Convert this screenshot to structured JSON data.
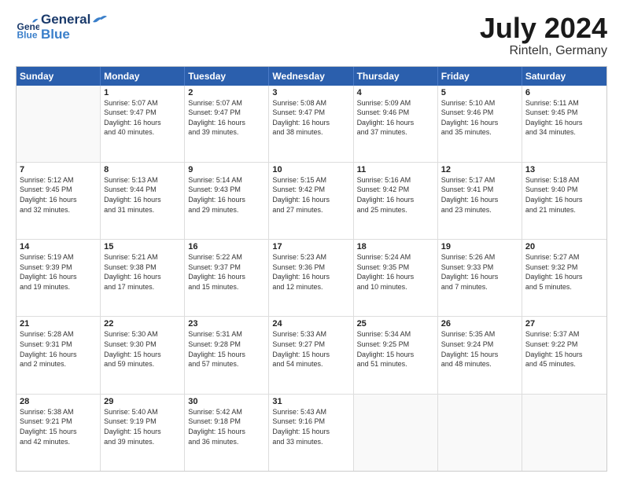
{
  "header": {
    "logo_general": "General",
    "logo_blue": "Blue",
    "title": "July 2024",
    "subtitle": "Rinteln, Germany"
  },
  "calendar": {
    "days_of_week": [
      "Sunday",
      "Monday",
      "Tuesday",
      "Wednesday",
      "Thursday",
      "Friday",
      "Saturday"
    ],
    "accent_color": "#2b5fad",
    "rows": [
      [
        {
          "day": "",
          "info": ""
        },
        {
          "day": "1",
          "info": "Sunrise: 5:07 AM\nSunset: 9:47 PM\nDaylight: 16 hours\nand 40 minutes."
        },
        {
          "day": "2",
          "info": "Sunrise: 5:07 AM\nSunset: 9:47 PM\nDaylight: 16 hours\nand 39 minutes."
        },
        {
          "day": "3",
          "info": "Sunrise: 5:08 AM\nSunset: 9:47 PM\nDaylight: 16 hours\nand 38 minutes."
        },
        {
          "day": "4",
          "info": "Sunrise: 5:09 AM\nSunset: 9:46 PM\nDaylight: 16 hours\nand 37 minutes."
        },
        {
          "day": "5",
          "info": "Sunrise: 5:10 AM\nSunset: 9:46 PM\nDaylight: 16 hours\nand 35 minutes."
        },
        {
          "day": "6",
          "info": "Sunrise: 5:11 AM\nSunset: 9:45 PM\nDaylight: 16 hours\nand 34 minutes."
        }
      ],
      [
        {
          "day": "7",
          "info": "Sunrise: 5:12 AM\nSunset: 9:45 PM\nDaylight: 16 hours\nand 32 minutes."
        },
        {
          "day": "8",
          "info": "Sunrise: 5:13 AM\nSunset: 9:44 PM\nDaylight: 16 hours\nand 31 minutes."
        },
        {
          "day": "9",
          "info": "Sunrise: 5:14 AM\nSunset: 9:43 PM\nDaylight: 16 hours\nand 29 minutes."
        },
        {
          "day": "10",
          "info": "Sunrise: 5:15 AM\nSunset: 9:42 PM\nDaylight: 16 hours\nand 27 minutes."
        },
        {
          "day": "11",
          "info": "Sunrise: 5:16 AM\nSunset: 9:42 PM\nDaylight: 16 hours\nand 25 minutes."
        },
        {
          "day": "12",
          "info": "Sunrise: 5:17 AM\nSunset: 9:41 PM\nDaylight: 16 hours\nand 23 minutes."
        },
        {
          "day": "13",
          "info": "Sunrise: 5:18 AM\nSunset: 9:40 PM\nDaylight: 16 hours\nand 21 minutes."
        }
      ],
      [
        {
          "day": "14",
          "info": "Sunrise: 5:19 AM\nSunset: 9:39 PM\nDaylight: 16 hours\nand 19 minutes."
        },
        {
          "day": "15",
          "info": "Sunrise: 5:21 AM\nSunset: 9:38 PM\nDaylight: 16 hours\nand 17 minutes."
        },
        {
          "day": "16",
          "info": "Sunrise: 5:22 AM\nSunset: 9:37 PM\nDaylight: 16 hours\nand 15 minutes."
        },
        {
          "day": "17",
          "info": "Sunrise: 5:23 AM\nSunset: 9:36 PM\nDaylight: 16 hours\nand 12 minutes."
        },
        {
          "day": "18",
          "info": "Sunrise: 5:24 AM\nSunset: 9:35 PM\nDaylight: 16 hours\nand 10 minutes."
        },
        {
          "day": "19",
          "info": "Sunrise: 5:26 AM\nSunset: 9:33 PM\nDaylight: 16 hours\nand 7 minutes."
        },
        {
          "day": "20",
          "info": "Sunrise: 5:27 AM\nSunset: 9:32 PM\nDaylight: 16 hours\nand 5 minutes."
        }
      ],
      [
        {
          "day": "21",
          "info": "Sunrise: 5:28 AM\nSunset: 9:31 PM\nDaylight: 16 hours\nand 2 minutes."
        },
        {
          "day": "22",
          "info": "Sunrise: 5:30 AM\nSunset: 9:30 PM\nDaylight: 15 hours\nand 59 minutes."
        },
        {
          "day": "23",
          "info": "Sunrise: 5:31 AM\nSunset: 9:28 PM\nDaylight: 15 hours\nand 57 minutes."
        },
        {
          "day": "24",
          "info": "Sunrise: 5:33 AM\nSunset: 9:27 PM\nDaylight: 15 hours\nand 54 minutes."
        },
        {
          "day": "25",
          "info": "Sunrise: 5:34 AM\nSunset: 9:25 PM\nDaylight: 15 hours\nand 51 minutes."
        },
        {
          "day": "26",
          "info": "Sunrise: 5:35 AM\nSunset: 9:24 PM\nDaylight: 15 hours\nand 48 minutes."
        },
        {
          "day": "27",
          "info": "Sunrise: 5:37 AM\nSunset: 9:22 PM\nDaylight: 15 hours\nand 45 minutes."
        }
      ],
      [
        {
          "day": "28",
          "info": "Sunrise: 5:38 AM\nSunset: 9:21 PM\nDaylight: 15 hours\nand 42 minutes."
        },
        {
          "day": "29",
          "info": "Sunrise: 5:40 AM\nSunset: 9:19 PM\nDaylight: 15 hours\nand 39 minutes."
        },
        {
          "day": "30",
          "info": "Sunrise: 5:42 AM\nSunset: 9:18 PM\nDaylight: 15 hours\nand 36 minutes."
        },
        {
          "day": "31",
          "info": "Sunrise: 5:43 AM\nSunset: 9:16 PM\nDaylight: 15 hours\nand 33 minutes."
        },
        {
          "day": "",
          "info": ""
        },
        {
          "day": "",
          "info": ""
        },
        {
          "day": "",
          "info": ""
        }
      ]
    ]
  }
}
